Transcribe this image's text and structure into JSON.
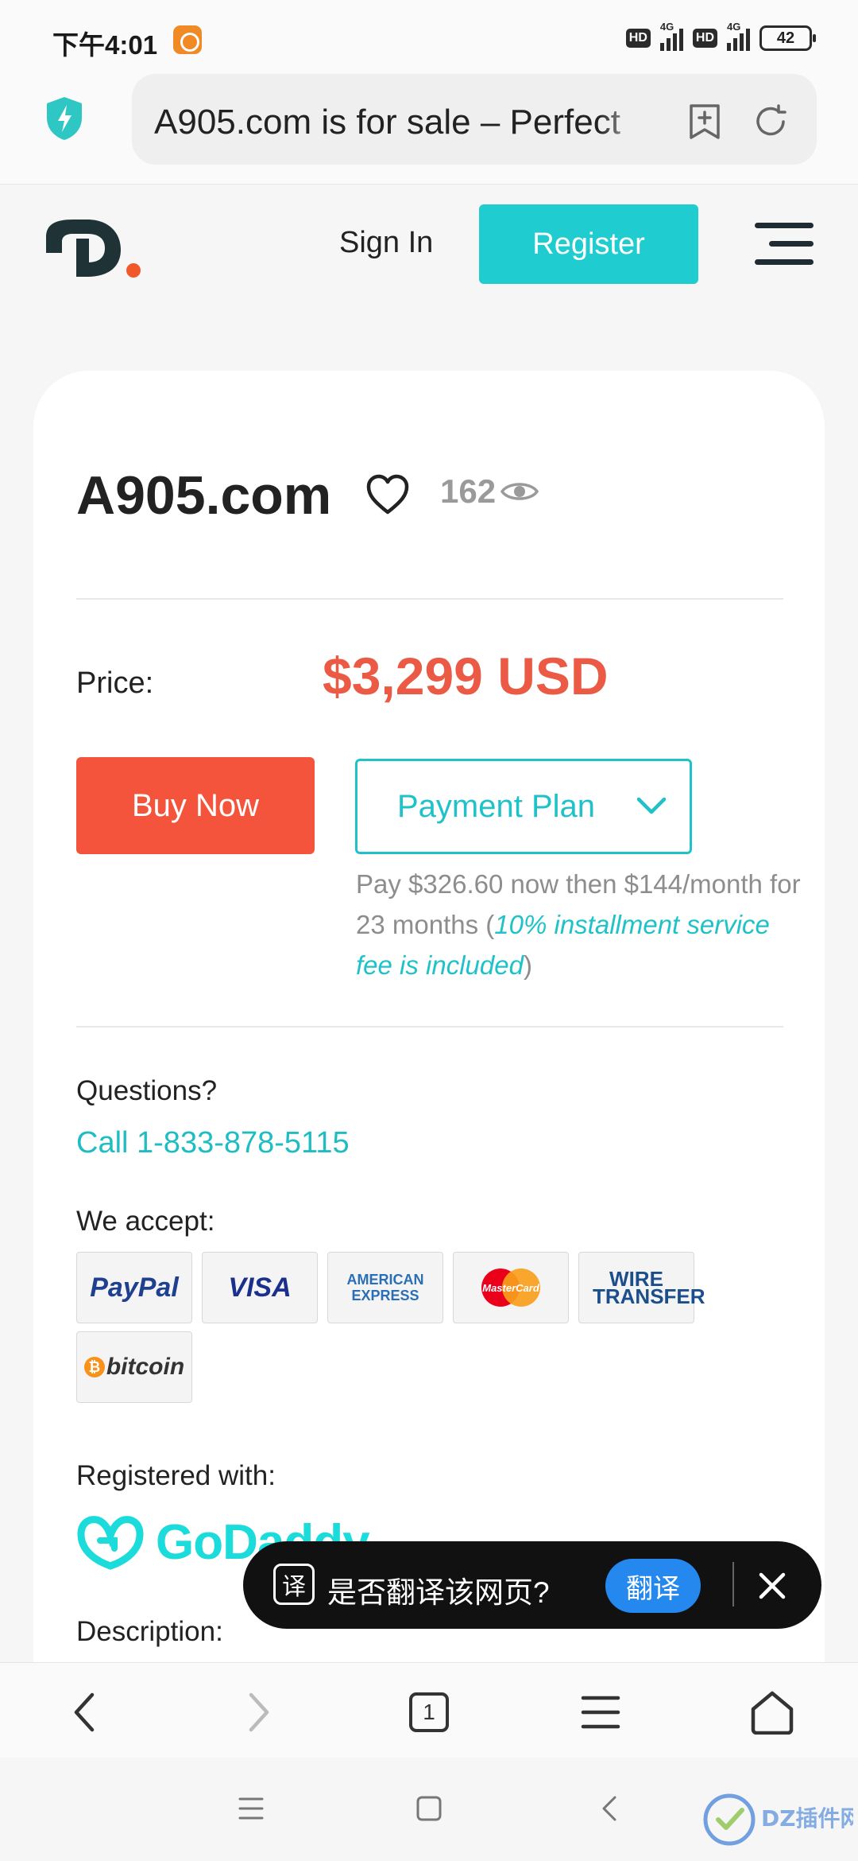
{
  "status_bar": {
    "time": "下午4:01",
    "network_1": "4G",
    "network_2": "4G",
    "hd_1": "HD",
    "hd_2": "HD",
    "battery": "42"
  },
  "browser": {
    "address_text": "A905.com is for sale – Perfect",
    "icons": [
      "shield-icon",
      "bookmark-add-icon",
      "refresh-icon"
    ]
  },
  "header": {
    "sign_in": "Sign In",
    "register": "Register"
  },
  "listing": {
    "domain": "A905.com",
    "views": "162",
    "price_label": "Price:",
    "price_value": "$3,299 USD",
    "buy_now": "Buy Now",
    "payment_plan": "Payment Plan",
    "plan_note_main": "Pay $326.60 now then $144/month for 23 months",
    "plan_note_fee": "10% installment service fee is included",
    "questions_label": "Questions?",
    "call_link": "Call 1-833-878-5115",
    "accept_label": "We accept:",
    "payment_methods": [
      "PayPal",
      "VISA",
      "AMERICAN EXPRESS",
      "MasterCard",
      "WIRE TRANSFER",
      "bitcoin"
    ],
    "registered_label": "Registered with:",
    "registrar": "GoDaddy",
    "description_label": "Description:"
  },
  "translate_popup": {
    "icon_text": "译",
    "prompt": "是否翻译该网页?",
    "button": "翻译"
  },
  "toolbar": {
    "tab_count": "1"
  },
  "colors": {
    "accent_teal": "#1fccd0",
    "price_red": "#ea5a45",
    "buy_button": "#f5543c",
    "translate_button": "#2488ef"
  }
}
